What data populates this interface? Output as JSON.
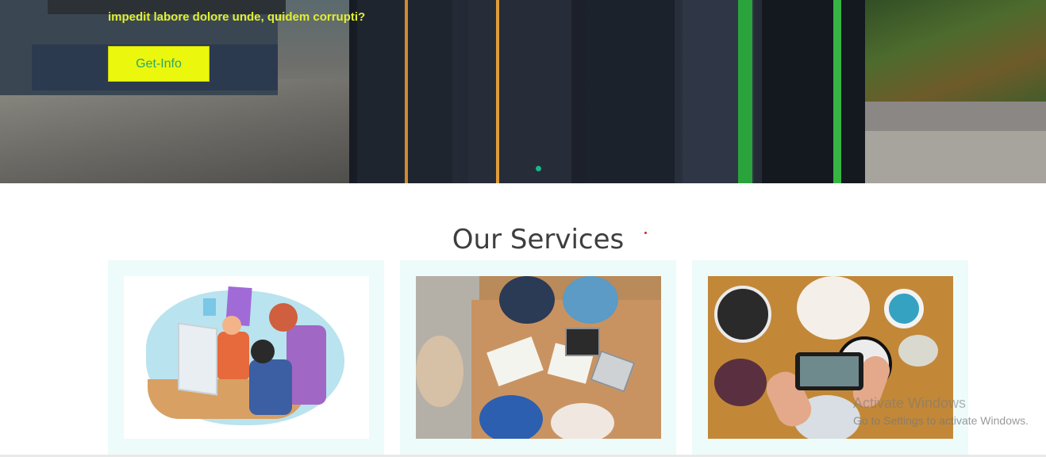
{
  "hero": {
    "subtitle": "impedit labore dolore unde, quidem corrupti?",
    "cta_label": "Get-Info"
  },
  "services": {
    "title": "Our Services",
    "cards": [
      {
        "image": "team-working-illustration"
      },
      {
        "image": "group-study-table-photo"
      },
      {
        "image": "food-photography-photo"
      }
    ]
  },
  "system_overlay": {
    "watermark_line1": "Activate Windows",
    "watermark_line2": "Go to Settings to activate Windows."
  },
  "colors": {
    "cta_background": "#ecf70e",
    "cta_text": "#2aa76b",
    "hero_text": "#e2ef2f",
    "card_background": "#edfbfa",
    "slider_dot": "#16b887",
    "title_text": "#3e3e3e"
  }
}
